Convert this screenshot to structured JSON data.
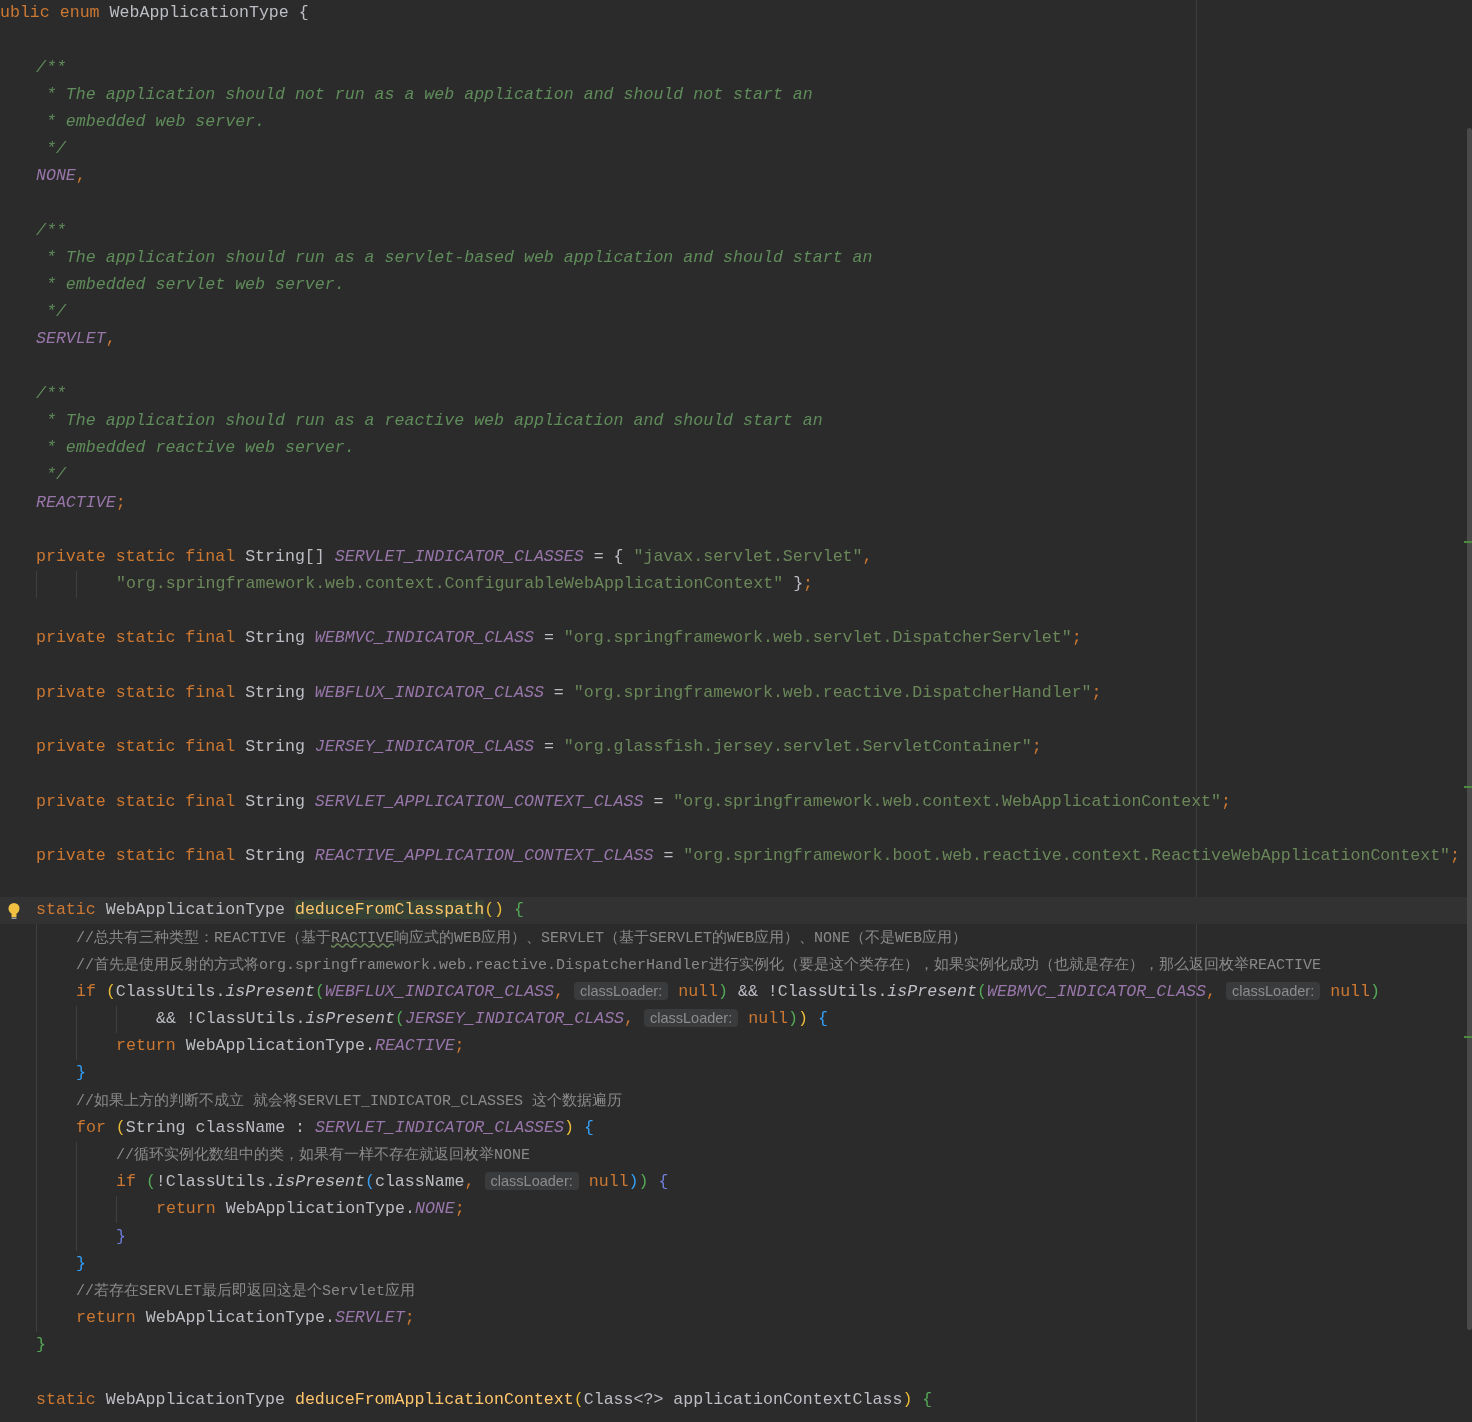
{
  "editor": {
    "lines": [
      {
        "kind": "code",
        "tokens": [
          {
            "kind": "kw",
            "text": "ublic enum "
          },
          {
            "kind": "plain",
            "text": "WebApplicationType {"
          }
        ],
        "children": [
          {
            "kind": "blank"
          },
          {
            "kind": "code",
            "tokens": [
              {
                "kind": "doc",
                "text": "/**"
              }
            ]
          },
          {
            "kind": "code",
            "tokens": [
              {
                "kind": "doc",
                "text": " * The application should not run as a web application and should not start an"
              }
            ]
          },
          {
            "kind": "code",
            "tokens": [
              {
                "kind": "doc",
                "text": " * embedded web server."
              }
            ]
          },
          {
            "kind": "code",
            "tokens": [
              {
                "kind": "doc",
                "text": " */"
              }
            ]
          },
          {
            "kind": "code",
            "tokens": [
              {
                "kind": "const",
                "text": "NONE"
              },
              {
                "kind": "kw",
                "text": ","
              }
            ]
          },
          {
            "kind": "blank"
          },
          {
            "kind": "code",
            "tokens": [
              {
                "kind": "doc",
                "text": "/**"
              }
            ]
          },
          {
            "kind": "code",
            "tokens": [
              {
                "kind": "doc",
                "text": " * The application should run as a servlet-based web application and should start an"
              }
            ]
          },
          {
            "kind": "code",
            "tokens": [
              {
                "kind": "doc",
                "text": " * embedded servlet web server."
              }
            ]
          },
          {
            "kind": "code",
            "tokens": [
              {
                "kind": "doc",
                "text": " */"
              }
            ]
          },
          {
            "kind": "code",
            "tokens": [
              {
                "kind": "const",
                "text": "SERVLET"
              },
              {
                "kind": "kw",
                "text": ","
              }
            ]
          },
          {
            "kind": "blank"
          },
          {
            "kind": "code",
            "tokens": [
              {
                "kind": "doc",
                "text": "/**"
              }
            ]
          },
          {
            "kind": "code",
            "tokens": [
              {
                "kind": "doc",
                "text": " * The application should run as a reactive web application and should start an"
              }
            ]
          },
          {
            "kind": "code",
            "tokens": [
              {
                "kind": "doc",
                "text": " * embedded reactive web server."
              }
            ]
          },
          {
            "kind": "code",
            "tokens": [
              {
                "kind": "doc",
                "text": " */"
              }
            ]
          },
          {
            "kind": "code",
            "tokens": [
              {
                "kind": "const",
                "text": "REACTIVE"
              },
              {
                "kind": "kw",
                "text": ";"
              }
            ]
          },
          {
            "kind": "blank"
          },
          {
            "kind": "code",
            "tokens": [
              {
                "kind": "kw",
                "text": "private static final "
              },
              {
                "kind": "plain",
                "text": "String[] "
              },
              {
                "kind": "const",
                "text": "SERVLET_INDICATOR_CLASSES"
              },
              {
                "kind": "plain",
                "text": " = { "
              },
              {
                "kind": "str",
                "text": "\"javax.servlet.Servlet\""
              },
              {
                "kind": "kw",
                "text": ","
              }
            ],
            "children": [
              {
                "kind": "continuation",
                "tokens": [
                  {
                    "kind": "str",
                    "text": "\"org.springframework.web.context.ConfigurableWebApplicationContext\""
                  },
                  {
                    "kind": "plain",
                    "text": " }"
                  },
                  {
                    "kind": "kw",
                    "text": ";"
                  }
                ]
              }
            ]
          },
          {
            "kind": "blank"
          },
          {
            "kind": "code",
            "tokens": [
              {
                "kind": "kw",
                "text": "private static final "
              },
              {
                "kind": "plain",
                "text": "String "
              },
              {
                "kind": "const",
                "text": "WEBMVC_INDICATOR_CLASS"
              },
              {
                "kind": "plain",
                "text": " = "
              },
              {
                "kind": "str",
                "text": "\"org.springframework.web.servlet.DispatcherServlet\""
              },
              {
                "kind": "kw",
                "text": ";"
              }
            ]
          },
          {
            "kind": "blank"
          },
          {
            "kind": "code",
            "tokens": [
              {
                "kind": "kw",
                "text": "private static final "
              },
              {
                "kind": "plain",
                "text": "String "
              },
              {
                "kind": "const",
                "text": "WEBFLUX_INDICATOR_CLASS"
              },
              {
                "kind": "plain",
                "text": " = "
              },
              {
                "kind": "str",
                "text": "\"org.springframework.web.reactive.DispatcherHandler\""
              },
              {
                "kind": "kw",
                "text": ";"
              }
            ]
          },
          {
            "kind": "blank"
          },
          {
            "kind": "code",
            "tokens": [
              {
                "kind": "kw",
                "text": "private static final "
              },
              {
                "kind": "plain",
                "text": "String "
              },
              {
                "kind": "const",
                "text": "JERSEY_INDICATOR_CLASS"
              },
              {
                "kind": "plain",
                "text": " = "
              },
              {
                "kind": "str",
                "text": "\"org.glassfish.jersey.servlet.ServletContainer\""
              },
              {
                "kind": "kw",
                "text": ";"
              }
            ]
          },
          {
            "kind": "blank"
          },
          {
            "kind": "code",
            "tokens": [
              {
                "kind": "kw",
                "text": "private static final "
              },
              {
                "kind": "plain",
                "text": "String "
              },
              {
                "kind": "const",
                "text": "SERVLET_APPLICATION_CONTEXT_CLASS"
              },
              {
                "kind": "plain",
                "text": " = "
              },
              {
                "kind": "str",
                "text": "\"org.springframework.web.context.WebApplicationContext\""
              },
              {
                "kind": "kw",
                "text": ";"
              }
            ]
          },
          {
            "kind": "blank"
          },
          {
            "kind": "code",
            "tokens": [
              {
                "kind": "kw",
                "text": "private static final "
              },
              {
                "kind": "plain",
                "text": "String "
              },
              {
                "kind": "const",
                "text": "REACTIVE_APPLICATION_CONTEXT_CLASS"
              },
              {
                "kind": "plain",
                "text": " = "
              },
              {
                "kind": "str",
                "text": "\"org.springframework.boot.web.reactive.context.ReactiveWebApplicationContext\""
              },
              {
                "kind": "kw",
                "text": ";"
              }
            ]
          },
          {
            "kind": "blank"
          },
          {
            "kind": "code",
            "current": true,
            "tokens": [
              {
                "kind": "kw",
                "text": "static "
              },
              {
                "kind": "plain",
                "text": "WebApplicationType "
              },
              {
                "kind": "method_hl",
                "text": "deduceFromClasspath"
              },
              {
                "kind": "p1",
                "text": "()"
              },
              {
                "kind": "p2",
                "text": " {"
              }
            ],
            "children": [
              {
                "kind": "code",
                "tokens": [
                  {
                    "kind": "comment",
                    "text": "//总共有三种类型：REACTIVE（基于"
                  },
                  {
                    "kind": "typo",
                    "text": "RACTIVE"
                  },
                  {
                    "kind": "comment",
                    "text": "响应式的WEB应用）、SERVLET（基于SERVLET的WEB应用）、NONE（不是WEB应用）"
                  }
                ]
              },
              {
                "kind": "code",
                "tokens": [
                  {
                    "kind": "comment",
                    "text": "//首先是使用反射的方式将org.springframework.web.reactive.DispatcherHandler进行实例化（要是这个类存在），如果实例化成功（也就是存在），那么返回枚举REACTIVE"
                  }
                ]
              },
              {
                "kind": "code",
                "tokens": [
                  {
                    "kind": "kw",
                    "text": "if "
                  },
                  {
                    "kind": "p1",
                    "text": "("
                  },
                  {
                    "kind": "plain",
                    "text": "ClassUtils."
                  },
                  {
                    "kind": "call",
                    "text": "isPresent"
                  },
                  {
                    "kind": "p2",
                    "text": "("
                  },
                  {
                    "kind": "const",
                    "text": "WEBFLUX_INDICATOR_CLASS"
                  },
                  {
                    "kind": "kw",
                    "text": ","
                  },
                  {
                    "kind": "hint",
                    "text": "classLoader:"
                  },
                  {
                    "kind": "kw",
                    "text": "null"
                  },
                  {
                    "kind": "p2",
                    "text": ")"
                  },
                  {
                    "kind": "plain",
                    "text": " && !ClassUtils."
                  },
                  {
                    "kind": "call",
                    "text": "isPresent"
                  },
                  {
                    "kind": "p2",
                    "text": "("
                  },
                  {
                    "kind": "const",
                    "text": "WEBMVC_INDICATOR_CLASS"
                  },
                  {
                    "kind": "kw",
                    "text": ","
                  },
                  {
                    "kind": "hint",
                    "text": "classLoader:"
                  },
                  {
                    "kind": "kw",
                    "text": "null"
                  },
                  {
                    "kind": "p2",
                    "text": ")"
                  }
                ],
                "children": [
                  {
                    "kind": "continuation",
                    "tokens": [
                      {
                        "kind": "plain",
                        "text": "&& !ClassUtils."
                      },
                      {
                        "kind": "call",
                        "text": "isPresent"
                      },
                      {
                        "kind": "p2",
                        "text": "("
                      },
                      {
                        "kind": "const",
                        "text": "JERSEY_INDICATOR_CLASS"
                      },
                      {
                        "kind": "kw",
                        "text": ","
                      },
                      {
                        "kind": "hint",
                        "text": "classLoader:"
                      },
                      {
                        "kind": "kw",
                        "text": "null"
                      },
                      {
                        "kind": "p2",
                        "text": ")"
                      },
                      {
                        "kind": "p1",
                        "text": ")"
                      },
                      {
                        "kind": "p3",
                        "text": " {"
                      }
                    ]
                  },
                  {
                    "kind": "code",
                    "tokens": [
                      {
                        "kind": "kw",
                        "text": "return "
                      },
                      {
                        "kind": "plain",
                        "text": "WebApplicationType."
                      },
                      {
                        "kind": "const",
                        "text": "REACTIVE"
                      },
                      {
                        "kind": "kw",
                        "text": ";"
                      }
                    ]
                  }
                ]
              },
              {
                "kind": "code",
                "tokens": [
                  {
                    "kind": "p3",
                    "text": "}"
                  }
                ]
              },
              {
                "kind": "code",
                "tokens": [
                  {
                    "kind": "comment",
                    "text": "//如果上方的判断不成立 就会将SERVLET_INDICATOR_CLASSES 这个数据遍历"
                  }
                ]
              },
              {
                "kind": "code",
                "tokens": [
                  {
                    "kind": "kw",
                    "text": "for "
                  },
                  {
                    "kind": "p1",
                    "text": "("
                  },
                  {
                    "kind": "plain",
                    "text": "String className : "
                  },
                  {
                    "kind": "const",
                    "text": "SERVLET_INDICATOR_CLASSES"
                  },
                  {
                    "kind": "p1",
                    "text": ")"
                  },
                  {
                    "kind": "p3",
                    "text": " {"
                  }
                ],
                "children": [
                  {
                    "kind": "code",
                    "tokens": [
                      {
                        "kind": "comment",
                        "text": "//循环实例化数组中的类，如果有一样不存在就返回枚举NONE"
                      }
                    ]
                  },
                  {
                    "kind": "code",
                    "tokens": [
                      {
                        "kind": "kw",
                        "text": "if "
                      },
                      {
                        "kind": "p2",
                        "text": "("
                      },
                      {
                        "kind": "plain",
                        "text": "!ClassUtils."
                      },
                      {
                        "kind": "call",
                        "text": "isPresent"
                      },
                      {
                        "kind": "p3",
                        "text": "("
                      },
                      {
                        "kind": "plain",
                        "text": "className"
                      },
                      {
                        "kind": "kw",
                        "text": ","
                      },
                      {
                        "kind": "hint",
                        "text": "classLoader:"
                      },
                      {
                        "kind": "kw",
                        "text": "null"
                      },
                      {
                        "kind": "p3",
                        "text": ")"
                      },
                      {
                        "kind": "p2",
                        "text": ")"
                      },
                      {
                        "kind": "p4",
                        "text": " {"
                      }
                    ],
                    "children": [
                      {
                        "kind": "code",
                        "tokens": [
                          {
                            "kind": "kw",
                            "text": "return "
                          },
                          {
                            "kind": "plain",
                            "text": "WebApplicationType."
                          },
                          {
                            "kind": "const",
                            "text": "NONE"
                          },
                          {
                            "kind": "kw",
                            "text": ";"
                          }
                        ]
                      }
                    ]
                  },
                  {
                    "kind": "code",
                    "tokens": [
                      {
                        "kind": "p4",
                        "text": "}"
                      }
                    ]
                  }
                ]
              },
              {
                "kind": "code",
                "tokens": [
                  {
                    "kind": "p3",
                    "text": "}"
                  }
                ]
              },
              {
                "kind": "code",
                "tokens": [
                  {
                    "kind": "comment",
                    "text": "//若存在SERVLET最后即返回这是个Servlet应用"
                  }
                ]
              },
              {
                "kind": "code",
                "tokens": [
                  {
                    "kind": "kw",
                    "text": "return "
                  },
                  {
                    "kind": "plain",
                    "text": "WebApplicationType."
                  },
                  {
                    "kind": "const",
                    "text": "SERVLET"
                  },
                  {
                    "kind": "kw",
                    "text": ";"
                  }
                ]
              }
            ]
          },
          {
            "kind": "code",
            "tokens": [
              {
                "kind": "p2",
                "text": "}"
              }
            ]
          },
          {
            "kind": "blank"
          },
          {
            "kind": "code",
            "tokens": [
              {
                "kind": "kw",
                "text": "static "
              },
              {
                "kind": "plain",
                "text": "WebApplicationType "
              },
              {
                "kind": "method",
                "text": "deduceFromApplicationContext"
              },
              {
                "kind": "p1",
                "text": "("
              },
              {
                "kind": "plain",
                "text": "Class<?> applicationContextClass"
              },
              {
                "kind": "p1",
                "text": ")"
              },
              {
                "kind": "p2",
                "text": " {"
              }
            ]
          }
        ]
      }
    ]
  }
}
